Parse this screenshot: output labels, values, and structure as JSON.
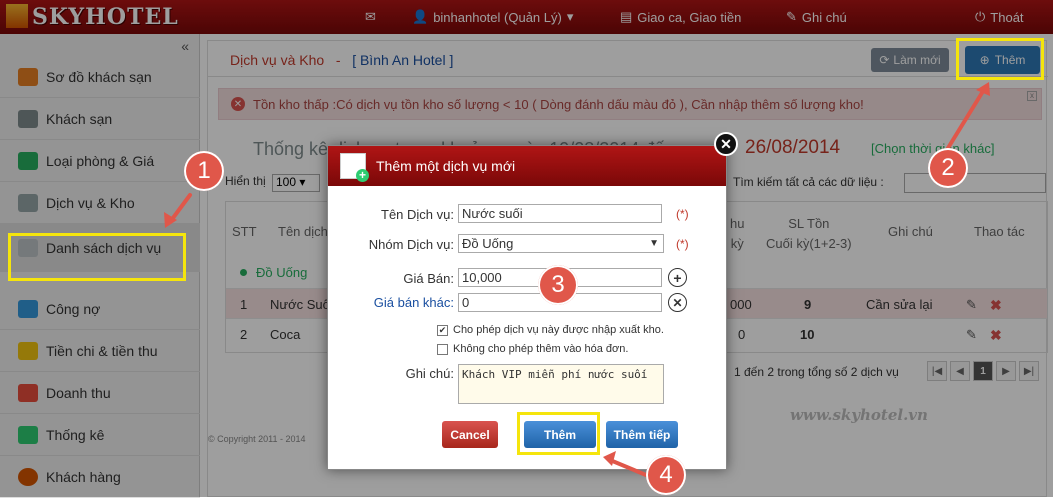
{
  "app": {
    "logo": "SKYHOTEL"
  },
  "nav": {
    "user": "binhanhotel (Quản Lý)",
    "shift": "Giao ca, Giao tiền",
    "notes": "Ghi chú",
    "logout": "Thoát"
  },
  "sidebar": {
    "collapse": "«",
    "items": [
      {
        "label": "Sơ đồ khách sạn"
      },
      {
        "label": "Khách sạn"
      },
      {
        "label": "Loại phòng & Giá"
      },
      {
        "label": "Dịch vụ & Kho"
      },
      {
        "label": "Danh sách dịch vụ"
      },
      {
        "label": "Công nợ"
      },
      {
        "label": "Tiền chi & tiền thu"
      },
      {
        "label": "Doanh thu"
      },
      {
        "label": "Thống kê"
      },
      {
        "label": "Khách hàng"
      }
    ]
  },
  "header": {
    "title": "Dịch vụ và Kho",
    "sep": "-",
    "hotel": "[ Bình An Hotel ]",
    "refresh": "Làm mới",
    "add": "Thêm"
  },
  "alert": {
    "icon": "✕",
    "text": "Tồn kho thấp :Có dịch vụ tồn kho số lượng < 10 ( Dòng đánh dấu màu đỏ ), Cần nhập thêm số lượng kho!",
    "close": "x"
  },
  "stats": {
    "title": "Thống kê dịch vụ trong khoảng ngày 19/08/2014 đến",
    "to_date": "26/08/2014",
    "choose": "[Chọn thời gian khác]"
  },
  "table_controls": {
    "show": "Hiển thị",
    "page_size": "100 ▾",
    "search": "Tìm kiếm tất cả các dữ liệu :"
  },
  "table": {
    "headers": [
      "STT",
      "Tên dịch",
      "hu\nkỳ",
      "SL Tồn\nCuối kỳ(1+2-3)",
      "Ghi chú",
      "Thao tác"
    ],
    "group": "Đồ Uống",
    "rows": [
      {
        "stt": "1",
        "name": "Nước Suố",
        "col": "000",
        "stock": "9",
        "note": "Cần sửa lại"
      },
      {
        "stt": "2",
        "name": "Coca",
        "col": "0",
        "stock": "10",
        "note": ""
      }
    ]
  },
  "pagination": {
    "info": "1 đến 2 trong tổng số 2 dịch vụ",
    "current": "1"
  },
  "footer": {
    "copyright": "© Copyright 2011 - 2014"
  },
  "watermark": "www.skyhotel.vn",
  "modal": {
    "title": "Thêm một dịch vụ mới",
    "close": "✕",
    "service_name_label": "Tên Dịch vụ:",
    "service_name": "Nước suối",
    "group_label": "Nhóm Dịch vụ:",
    "group": "Đồ Uống",
    "price_label": "Giá Bán:",
    "price": "10,000",
    "other_price_label": "Giá bán khác:",
    "other_price": "0",
    "required": "(*)",
    "chk1": "Cho phép dịch vụ này được nhập xuất kho.",
    "chk2": "Không cho phép thêm vào hóa đơn.",
    "note_label": "Ghi chú:",
    "note": "Khách VIP miễn phí nước suối",
    "cancel": "Cancel",
    "add": "Thêm",
    "add_more": "Thêm tiếp"
  },
  "annotations": {
    "b1": "1",
    "b2": "2",
    "b3": "3",
    "b4": "4"
  },
  "colors": {
    "brand": "#9b1010",
    "highlight": "#f5e50c",
    "badge": "#e0574a"
  }
}
